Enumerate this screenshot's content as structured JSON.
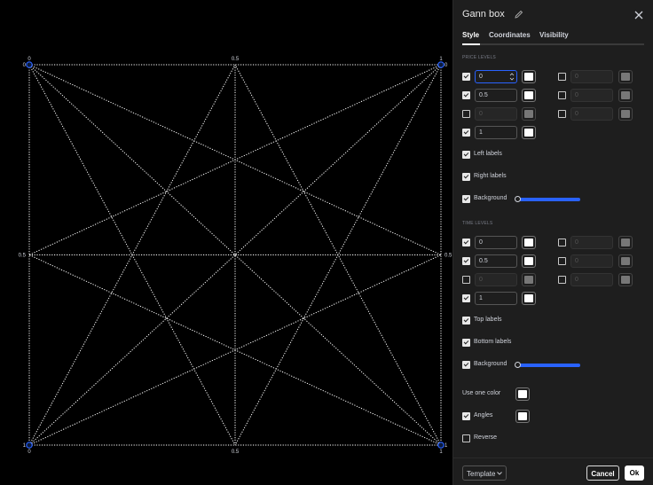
{
  "chart": {
    "top_labels": [
      "0",
      "0.5",
      "1"
    ],
    "bottom_labels": [
      "0",
      "0.5",
      "1"
    ],
    "left_labels": [
      "0",
      "0.5",
      "1"
    ],
    "right_labels": [
      "0",
      "0.5",
      "1"
    ],
    "line_color": "#ffffff",
    "handle_color": "#2962ff"
  },
  "dialog": {
    "title": "Gann box",
    "tabs": [
      "Style",
      "Coordinates",
      "Visibility"
    ],
    "active_tab": "Style",
    "price_section": "PRICE LEVELS",
    "price_levels": [
      {
        "value": "0",
        "enabled": true
      },
      {
        "value": "0.5",
        "enabled": true
      },
      {
        "value": "0",
        "enabled": false
      },
      {
        "value": "1",
        "enabled": true
      }
    ],
    "price_levels_right": [
      {
        "value": "0",
        "enabled": false
      },
      {
        "value": "0",
        "enabled": false
      },
      {
        "value": "0",
        "enabled": false
      }
    ],
    "left_labels": "Left labels",
    "right_labels": "Right labels",
    "background": "Background",
    "time_section": "TIME LEVELS",
    "time_levels": [
      {
        "value": "0",
        "enabled": true
      },
      {
        "value": "0.5",
        "enabled": true
      },
      {
        "value": "0",
        "enabled": false
      },
      {
        "value": "1",
        "enabled": true
      }
    ],
    "time_levels_right": [
      {
        "value": "0",
        "enabled": false
      },
      {
        "value": "0",
        "enabled": false
      },
      {
        "value": "0",
        "enabled": false
      }
    ],
    "top_labels": "Top labels",
    "bottom_labels": "Bottom labels",
    "background2": "Background",
    "use_one_color": "Use one color",
    "angles": "Angles",
    "reverse": "Reverse",
    "template": "Template",
    "cancel": "Cancel",
    "ok": "Ok",
    "accent_color": "#2962ff"
  }
}
